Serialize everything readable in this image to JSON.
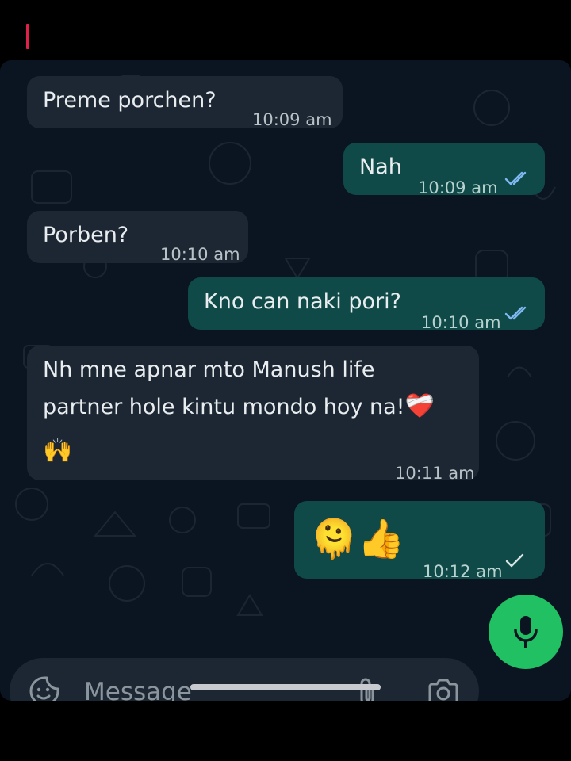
{
  "messages": [
    {
      "direction": "incoming",
      "text": "Preme porchen?",
      "time": "10:09 am"
    },
    {
      "direction": "outgoing",
      "text": "Nah",
      "time": "10:09 am",
      "status": "read"
    },
    {
      "direction": "incoming",
      "text": "Porben?",
      "time": "10:10 am"
    },
    {
      "direction": "outgoing",
      "text": "Kno can naki pori?",
      "time": "10:10 am",
      "status": "read"
    },
    {
      "direction": "incoming",
      "line1": "Nh mne apnar mto Manush life",
      "line2": "partner hole kintu mondo hoy na!",
      "emoji_inline": "❤️‍🩹",
      "emoji_below": "🙌",
      "time": "10:11 am"
    },
    {
      "direction": "outgoing",
      "emojis": "🫠👍",
      "time": "10:12 am",
      "status": "sent"
    }
  ],
  "composer": {
    "placeholder": "Message",
    "icons": [
      "sticker-icon",
      "attach-icon",
      "camera-icon",
      "mic-icon"
    ]
  },
  "colors": {
    "background": "#0b1421",
    "incoming_bubble": "#1c2733",
    "outgoing_bubble": "#0f4a49",
    "read_ticks": "#7fb8f0",
    "mic_button": "#21c063",
    "recording_indicator": "#e0204a"
  }
}
